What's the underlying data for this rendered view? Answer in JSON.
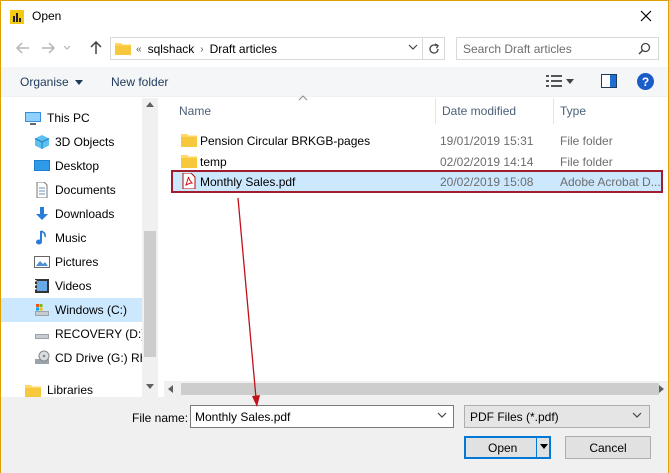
{
  "window": {
    "title": "Open"
  },
  "address": {
    "overflow": "«",
    "crumbs": [
      "sqlshack",
      "Draft articles"
    ]
  },
  "search": {
    "placeholder": "Search Draft articles"
  },
  "toolbar": {
    "organise_label": "Organise",
    "new_folder_label": "New folder",
    "help_label": "?"
  },
  "nav": {
    "this_pc": "This PC",
    "items": [
      {
        "label": "3D Objects",
        "icon": "3d-objects-icon"
      },
      {
        "label": "Desktop",
        "icon": "desktop-icon"
      },
      {
        "label": "Documents",
        "icon": "documents-icon"
      },
      {
        "label": "Downloads",
        "icon": "downloads-icon"
      },
      {
        "label": "Music",
        "icon": "music-icon"
      },
      {
        "label": "Pictures",
        "icon": "pictures-icon"
      },
      {
        "label": "Videos",
        "icon": "videos-icon"
      },
      {
        "label": "Windows (C:)",
        "icon": "drive-icon",
        "selected": true
      },
      {
        "label": "RECOVERY (D:)",
        "icon": "drive-icon"
      },
      {
        "label": "CD Drive (G:) RH",
        "icon": "cd-drive-icon"
      }
    ],
    "libraries": "Libraries"
  },
  "columns": {
    "name": "Name",
    "date": "Date modified",
    "type": "Type"
  },
  "files": [
    {
      "name": "Pension Circular BRKGB-pages",
      "date": "19/01/2019 15:31",
      "type": "File folder",
      "icon": "folder-icon"
    },
    {
      "name": "temp",
      "date": "02/02/2019 14:14",
      "type": "File folder",
      "icon": "folder-icon"
    },
    {
      "name": "Monthly Sales.pdf",
      "date": "20/02/2019 15:08",
      "type": "Adobe Acrobat D...",
      "icon": "pdf-icon",
      "selected": true
    }
  ],
  "bottom": {
    "file_name_label": "File name:",
    "file_name_value": "Monthly Sales.pdf",
    "file_type": "PDF Files (*.pdf)",
    "open_label": "Open",
    "cancel_label": "Cancel"
  },
  "colors": {
    "accent": "#0078d7",
    "selection": "#cce8ff",
    "highlight_border": "#a01c2e",
    "window_border": "#e0a000"
  }
}
